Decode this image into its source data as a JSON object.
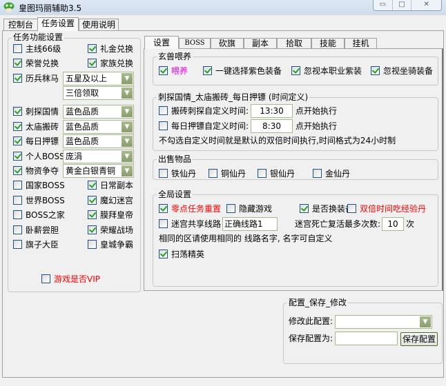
{
  "window": {
    "title": "皇图玛丽辅助3.5",
    "controls": [
      "minimize",
      "maximize",
      "close"
    ]
  },
  "main_tabs": [
    {
      "label": "控制台"
    },
    {
      "label": "任务设置",
      "selected": true
    },
    {
      "label": "使用说明"
    }
  ],
  "task_group": {
    "title": "任务功能设置",
    "items": [
      {
        "label": "主线66级",
        "checked": false
      },
      {
        "label": "礼金兑换",
        "checked": true
      },
      {
        "label": "荣誉兑换",
        "checked": true
      },
      {
        "label": "家族兑换",
        "checked": true
      },
      {
        "label": "历兵秣马",
        "checked": true,
        "select": "五星及以上",
        "select2": "三倍领取"
      },
      {
        "label": "刺探国情",
        "checked": true,
        "select": "蓝色品质"
      },
      {
        "label": "太庙搬砖",
        "checked": true,
        "select": "蓝色品质"
      },
      {
        "label": "每日押镖",
        "checked": true,
        "select": "蓝色品质"
      },
      {
        "label": "个人BOSS",
        "checked": true,
        "select": "庞涓"
      },
      {
        "label": "物资争夺",
        "checked": true,
        "select": "黄金白银青铜"
      },
      {
        "label": "国家BOSS",
        "checked": false
      },
      {
        "label": "日常副本",
        "checked": true
      },
      {
        "label": "世界BOSS",
        "checked": false
      },
      {
        "label": "魔幻迷宫",
        "checked": true
      },
      {
        "label": "BOSS之家",
        "checked": false
      },
      {
        "label": "膜拜皇帝",
        "checked": true
      },
      {
        "label": "卧薪尝胆",
        "checked": false
      },
      {
        "label": "荣耀战场",
        "checked": true
      },
      {
        "label": "旗子大臣",
        "checked": false
      },
      {
        "label": "皇城争霸",
        "checked": false
      }
    ],
    "vip": {
      "label": "游戏是否VIP",
      "checked": false
    }
  },
  "sub_tabs": [
    {
      "label": "设置",
      "selected": true
    },
    {
      "label": "BOSS"
    },
    {
      "label": "砍旗"
    },
    {
      "label": "副本"
    },
    {
      "label": "拾取"
    },
    {
      "label": "技能"
    },
    {
      "label": "挂机"
    }
  ],
  "pet": {
    "title": "玄兽喂养",
    "items": [
      {
        "label": "喂养",
        "checked": true
      },
      {
        "label": "一键选择紫色装备",
        "checked": true
      },
      {
        "label": "忽视本职业紫装",
        "checked": true
      },
      {
        "label": "忽视坐骑装备",
        "checked": true
      }
    ]
  },
  "timing": {
    "title": "刺探国情_太庙搬砖_每日押镖 (时间定义)",
    "rows": [
      {
        "label": "搬砖刺探自定义时间:",
        "checked": false,
        "value": "13:30",
        "suffix": "点开始执行"
      },
      {
        "label": "每日押镖自定义时间:",
        "checked": false,
        "value": "8:30",
        "suffix": "点开始执行"
      }
    ],
    "note": "不勾选自定义时间就是默认的双倍时间执行,时间格式为24小时制"
  },
  "sell": {
    "title": "出售物品",
    "items": [
      {
        "label": "铁仙丹",
        "checked": false
      },
      {
        "label": "铜仙丹",
        "checked": false
      },
      {
        "label": "银仙丹",
        "checked": false
      },
      {
        "label": "金仙丹",
        "checked": false
      }
    ]
  },
  "global": {
    "title": "全局设置",
    "items": [
      {
        "label": "零点任务重置",
        "checked": true
      },
      {
        "label": "隐藏游戏",
        "checked": false
      },
      {
        "label": "是否换装备",
        "checked": true
      },
      {
        "label": "双倍时间吃经验丹",
        "checked": false
      }
    ],
    "maze": {
      "label": "迷宫共享线路",
      "checked": false,
      "value": "正确线路1",
      "revive_label": "迷宫死亡复活最多次数:",
      "revive_value": "10",
      "revive_unit": "次"
    },
    "note": "相同的区请使用相同的 线路名字, 名字可自定义",
    "sweep": {
      "label": "扫荡精英",
      "checked": true
    }
  },
  "config": {
    "title": "配置_保存_修改",
    "modify_label": "修改此配置:",
    "modify_value": "",
    "save_as_label": "保存配置为:",
    "save_as_value": "",
    "save_button": "保存配置"
  },
  "colors": {
    "check": "#21a121",
    "red_text": "#ff0000",
    "magenta_text": "#ff00ff",
    "input_border": "#a5b98a"
  }
}
